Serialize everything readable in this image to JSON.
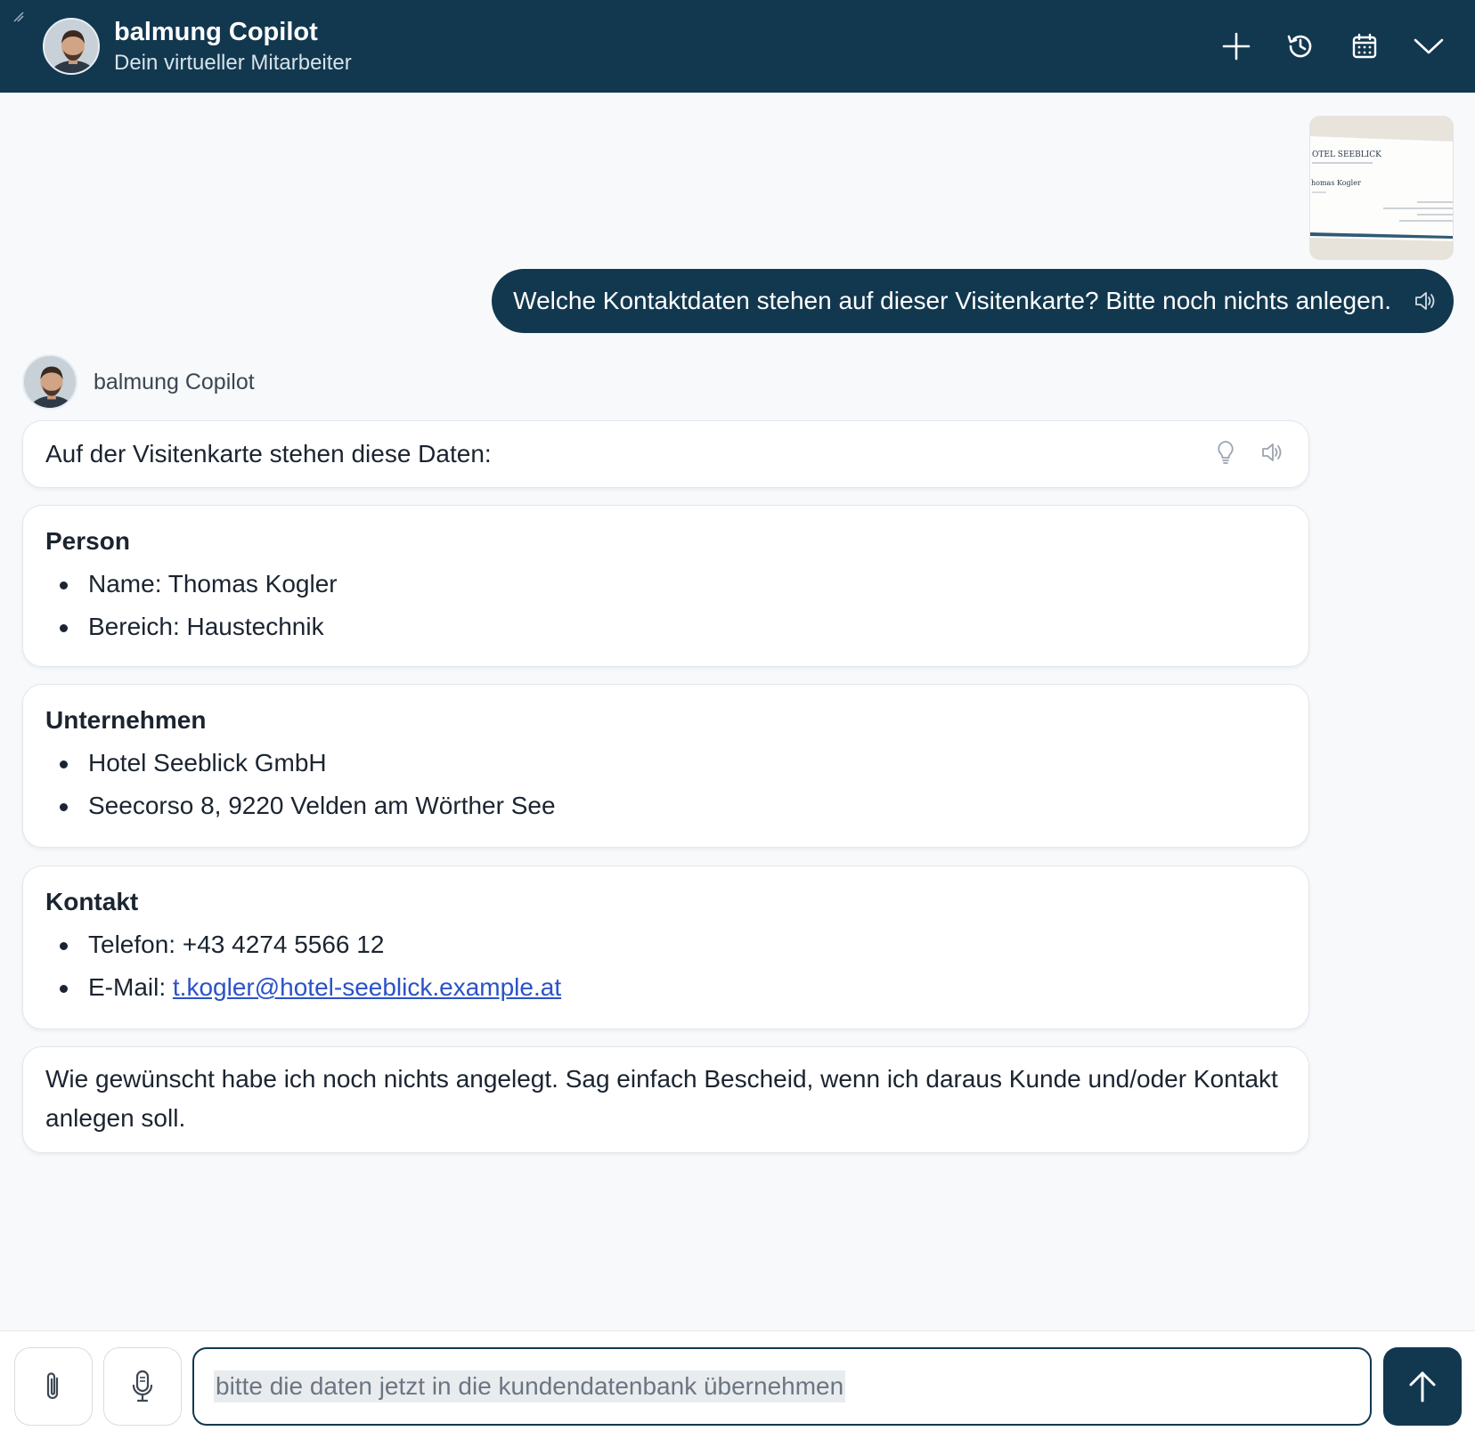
{
  "header": {
    "title": "balmung Copilot",
    "subtitle": "Dein virtueller Mitarbeiter",
    "actions": [
      "plus-icon",
      "history-icon",
      "calendar-icon",
      "chevron-down-icon"
    ]
  },
  "colors": {
    "header_bg": "#12384f",
    "user_bubble_bg": "#12384f",
    "link": "#2a52c9",
    "page_bg": "#f7f9fb"
  },
  "attachment": {
    "card_lines": [
      "OTEL SEEBLICK",
      "homas Kogler"
    ]
  },
  "user_message": {
    "text": "Welche Kontaktdaten stehen auf dieser Visitenkarte? Bitte noch nichts anlegen."
  },
  "bot": {
    "name": "balmung Copilot",
    "intro": "Auf der Visitenkarte stehen diese Daten:",
    "sections": [
      {
        "heading": "Person",
        "items": [
          "Name: Thomas Kogler",
          "Bereich: Haustechnik"
        ]
      },
      {
        "heading": "Unternehmen",
        "items": [
          "Hotel Seeblick GmbH",
          "Seecorso 8, 9220 Velden am Wörther See"
        ]
      },
      {
        "heading": "Kontakt",
        "items": [
          "Telefon: +43 4274 5566 12"
        ],
        "email_label": "E-Mail: ",
        "email": "t.kogler@hotel-seeblick.example.at"
      }
    ],
    "closing": "Wie gewünscht habe ich noch nichts angelegt. Sag einfach Bescheid, wenn ich daraus Kunde und/oder Kontakt anlegen soll."
  },
  "composer": {
    "value": "bitte die daten jetzt in die kundendatenbank übernehmen"
  }
}
